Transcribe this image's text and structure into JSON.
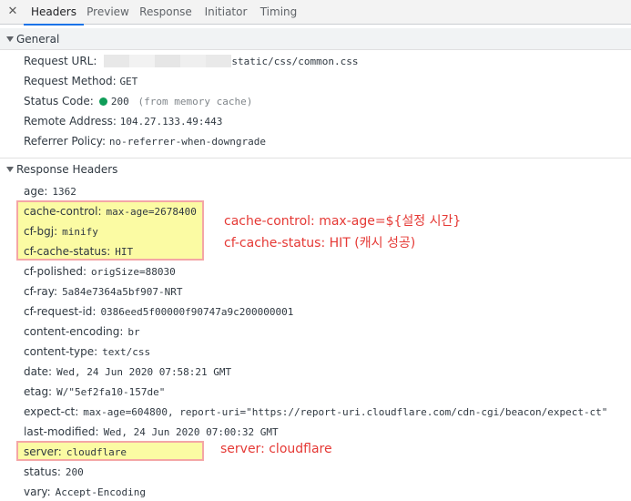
{
  "tabs": [
    {
      "label": "Headers",
      "active": true
    },
    {
      "label": "Preview",
      "active": false
    },
    {
      "label": "Response",
      "active": false
    },
    {
      "label": "Initiator",
      "active": false
    },
    {
      "label": "Timing",
      "active": false
    }
  ],
  "close_icon": "close-icon",
  "general": {
    "title": "General",
    "request_url": {
      "key": "Request URL:",
      "value": "static/css/common.css"
    },
    "request_method": {
      "key": "Request Method:",
      "value": "GET"
    },
    "status_code": {
      "key": "Status Code:",
      "code": "200",
      "note": "(from memory cache)",
      "dot_color": "#0f9d58"
    },
    "remote_address": {
      "key": "Remote Address:",
      "value": "104.27.133.49:443"
    },
    "referrer_policy": {
      "key": "Referrer Policy:",
      "value": "no-referrer-when-downgrade"
    }
  },
  "response_headers": {
    "title": "Response Headers",
    "items": [
      {
        "key": "age:",
        "value": "1362"
      },
      {
        "key": "cache-control:",
        "value": "max-age=2678400"
      },
      {
        "key": "cf-bgj:",
        "value": "minify"
      },
      {
        "key": "cf-cache-status:",
        "value": "HIT"
      },
      {
        "key": "cf-polished:",
        "value": "origSize=88030"
      },
      {
        "key": "cf-ray:",
        "value": "5a84e7364a5bf907-NRT"
      },
      {
        "key": "cf-request-id:",
        "value": "0386eed5f00000f90747a9c200000001"
      },
      {
        "key": "content-encoding:",
        "value": "br"
      },
      {
        "key": "content-type:",
        "value": "text/css"
      },
      {
        "key": "date:",
        "value": "Wed, 24 Jun 2020 07:58:21 GMT"
      },
      {
        "key": "etag:",
        "value": "W/\"5ef2fa10-157de\""
      },
      {
        "key": "expect-ct:",
        "value": "max-age=604800, report-uri=\"https://report-uri.cloudflare.com/cdn-cgi/beacon/expect-ct\""
      },
      {
        "key": "last-modified:",
        "value": "Wed, 24 Jun 2020 07:00:32 GMT"
      },
      {
        "key": "server:",
        "value": "cloudflare"
      },
      {
        "key": "status:",
        "value": "200"
      },
      {
        "key": "vary:",
        "value": "Accept-Encoding"
      }
    ]
  },
  "annotations": {
    "cache_control": "cache-control: max-age=${설정 시간}",
    "cache_status": "cf-cache-status: HIT (캐시 성공)",
    "server": "server: cloudflare"
  },
  "colors": {
    "highlight_fill": "#fbfba3",
    "highlight_border": "#f4a6a6",
    "annotation_text": "#e53935",
    "active_tab_underline": "#1a73e8"
  }
}
